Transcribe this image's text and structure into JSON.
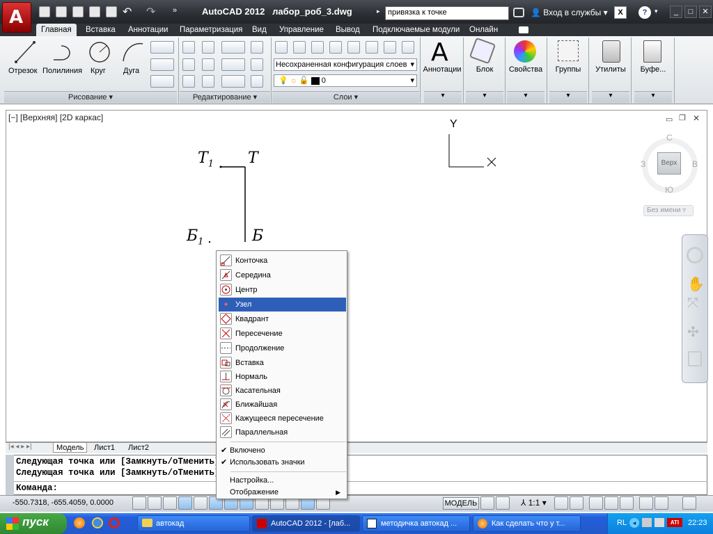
{
  "app": {
    "logo_letter": "A",
    "title": "AutoCAD 2012",
    "document": "лабор_роб_3.dwg",
    "search_value": "привязка к точке",
    "sign_in": "Вход в службы",
    "help_icon": "?",
    "window_controls": [
      "_",
      "□",
      "✕"
    ]
  },
  "tabs": [
    "Главная",
    "Вставка",
    "Аннотации",
    "Параметризация",
    "Вид",
    "Управление",
    "Вывод",
    "Подключаемые модули",
    "Онлайн"
  ],
  "active_tab": "Главная",
  "ribbon": {
    "draw": {
      "tools": [
        "Отрезок",
        "Полилиния",
        "Круг",
        "Дуга"
      ],
      "title": "Рисование"
    },
    "modify": {
      "title": "Редактирование"
    },
    "layers": {
      "title": "Слои",
      "config": "Несохраненная конфигурация слоев",
      "current_layer": "0"
    },
    "big": [
      "Аннотации",
      "Блок",
      "Свойства",
      "Группы",
      "Утилиты",
      "Буфе..."
    ]
  },
  "viewport": {
    "label": "[−] [Верхняя] [2D каркас]",
    "points": {
      "t1": "Т",
      "t1_sub": "1",
      "t": "Т",
      "b1": "Б",
      "b1_sub": "1",
      "b": "Б"
    },
    "ucs": {
      "x": "X",
      "y": "Y"
    },
    "viewcube": {
      "north": "С",
      "south": "Ю",
      "west": "З",
      "east": "В",
      "face": "Верх",
      "ucs_name": "Без имени"
    }
  },
  "layout_tabs": [
    "Модель",
    "Лист1",
    "Лист2"
  ],
  "active_layout": "Модель",
  "command": {
    "lines": [
      "Следующая точка или [Замкнуть/оТменить]:",
      "Следующая точка или [Замкнуть/оТменить]:"
    ],
    "prompt": "Команда:"
  },
  "status": {
    "coords": "-550.7318, -655.4059, 0.0000",
    "model": "МОДЕЛЬ",
    "scale": "1:1"
  },
  "context_menu": {
    "items": [
      {
        "label": "Конточка",
        "icon": "endpoint-icon"
      },
      {
        "label": "Середина",
        "icon": "midpoint-icon"
      },
      {
        "label": "Центр",
        "icon": "center-icon"
      },
      {
        "label": "Узел",
        "icon": "node-icon"
      },
      {
        "label": "Квадрант",
        "icon": "quadrant-icon"
      },
      {
        "label": "Пересечение",
        "icon": "intersection-icon"
      },
      {
        "label": "Продолжение",
        "icon": "extension-icon"
      },
      {
        "label": "Вставка",
        "icon": "insert-icon"
      },
      {
        "label": "Нормаль",
        "icon": "perpendicular-icon"
      },
      {
        "label": "Касательная",
        "icon": "tangent-icon"
      },
      {
        "label": "Ближайшая",
        "icon": "nearest-icon"
      },
      {
        "label": "Кажущееся пересечение",
        "icon": "apparent-intersection-icon"
      },
      {
        "label": "Параллельная",
        "icon": "parallel-icon"
      }
    ],
    "selected": "Узел",
    "toggles": [
      "Включено",
      "Использовать значки"
    ],
    "settings": "Настройка...",
    "display": "Отображение"
  },
  "taskbar": {
    "start": "пуск",
    "tasks": [
      "автокад",
      "AutoCAD 2012 - [лаб...",
      "методичка автокад ...",
      "Как сделать что у т..."
    ],
    "lang": "RL",
    "clock": "22:23"
  }
}
